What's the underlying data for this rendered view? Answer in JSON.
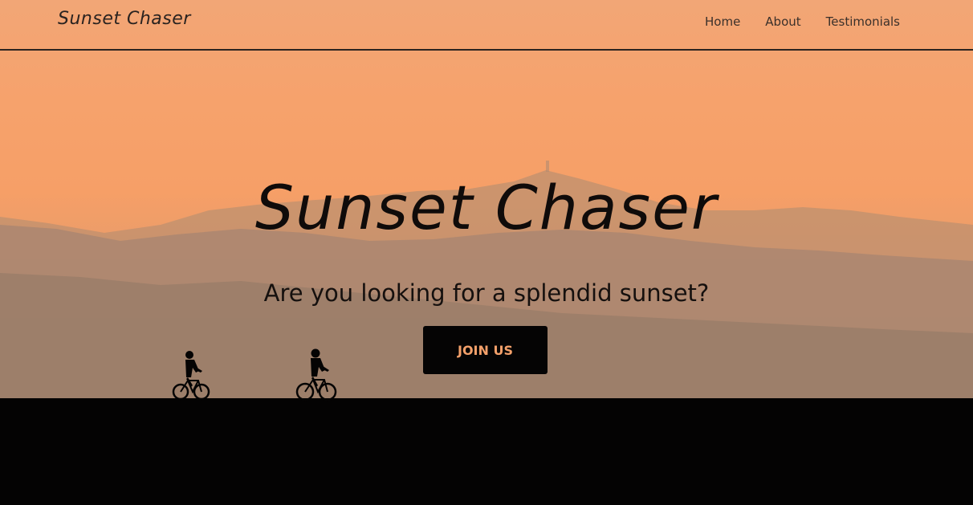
{
  "navbar": {
    "brand": "Sunset Chaser",
    "links": [
      {
        "label": "Home"
      },
      {
        "label": "About"
      },
      {
        "label": "Testimonials"
      }
    ]
  },
  "hero": {
    "title": "Sunset Chaser",
    "subtitle": "Are you looking for a splendid sunset?",
    "cta_label": "JOIN US"
  },
  "colors": {
    "sky": "#f6a26c",
    "accent": "#f3a06a",
    "ground": "#040303",
    "text_dark": "#0f0b0a"
  },
  "icons": [
    "cyclist-silhouette",
    "cyclist-silhouette"
  ]
}
